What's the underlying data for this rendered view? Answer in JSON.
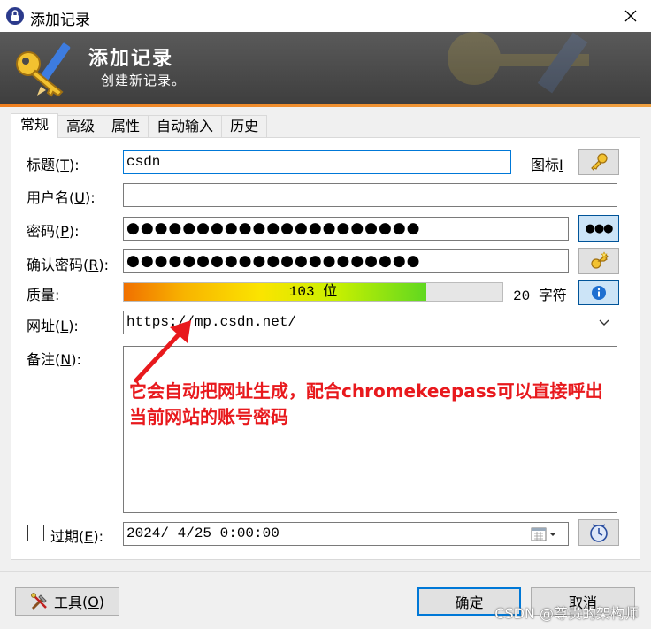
{
  "window": {
    "title": "添加记录",
    "close_glyph": "✕"
  },
  "banner": {
    "title": "添加记录",
    "subtitle": "创建新记录。"
  },
  "tabs": [
    {
      "label": "常规",
      "active": true
    },
    {
      "label": "高级",
      "active": false
    },
    {
      "label": "属性",
      "active": false
    },
    {
      "label": "自动输入",
      "active": false
    },
    {
      "label": "历史",
      "active": false
    }
  ],
  "form": {
    "title_label": "标题",
    "title_key": "T",
    "title_value": "csdn",
    "icon_label": "图标",
    "icon_key": "I",
    "username_label": "用户名",
    "username_key": "U",
    "username_value": "",
    "password_label": "密码",
    "password_key": "P",
    "password_value": "●●●●●●●●●●●●●●●●●●●●●",
    "repeat_label": "确认密码",
    "repeat_key": "R",
    "repeat_value": "●●●●●●●●●●●●●●●●●●●●●",
    "show_password_glyph": "●●●",
    "quality_label": "质量:",
    "quality_text": "103 位",
    "quality_fraction": 0.8,
    "quality_chars": "20 字符",
    "url_label": "网址",
    "url_key": "L",
    "url_value": "https://mp.csdn.net/",
    "notes_label": "备注",
    "notes_key": "N",
    "expires_label": "过期",
    "expires_key": "E",
    "expires_checked": false,
    "expires_value": "2024/ 4/25  0:00:00"
  },
  "annotation": {
    "line1": "它会自动把网址生成，配合chromekeepass可以直接呼出",
    "line2": "当前网站的账号密码"
  },
  "footer": {
    "tools_label": "工具",
    "tools_key": "O",
    "ok_label": "确定",
    "cancel_label": "取消",
    "watermark": "CSDN @尊贵的架构师"
  },
  "colors": {
    "accent": "#0078d7",
    "annotation": "#e8191d",
    "banner": "#4a4a4a",
    "banner_line": "#f08020"
  }
}
